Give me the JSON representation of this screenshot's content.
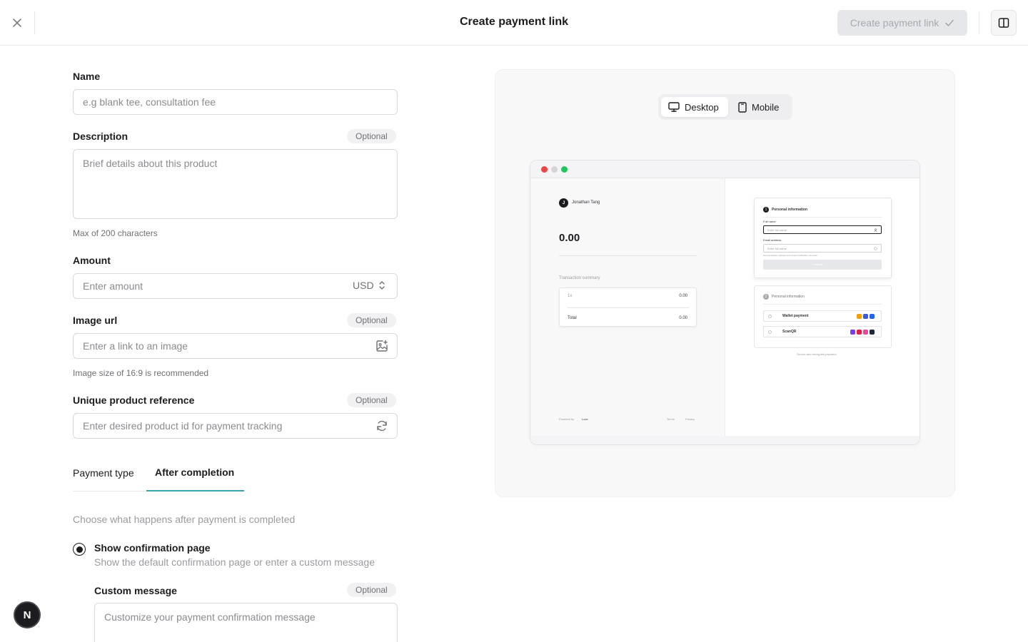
{
  "header": {
    "title": "Create payment link",
    "create_button_label": "Create payment link"
  },
  "form": {
    "name": {
      "label": "Name",
      "placeholder": "e.g blank tee, consultation fee"
    },
    "description": {
      "label": "Description",
      "badge": "Optional",
      "placeholder": "Brief details about this product",
      "hint": "Max of 200 characters"
    },
    "amount": {
      "label": "Amount",
      "placeholder": "Enter amount",
      "currency": "USD"
    },
    "image_url": {
      "label": "Image url",
      "badge": "Optional",
      "placeholder": "Enter a link to an image",
      "hint": "Image size of 16:9 is recommended"
    },
    "product_reference": {
      "label": "Unique product reference",
      "badge": "Optional",
      "placeholder": "Enter desired product id for payment tracking"
    },
    "tabs": [
      {
        "label": "Payment type",
        "active": false
      },
      {
        "label": "After completion",
        "active": true
      }
    ],
    "after_completion": {
      "description": "Choose what happens after payment is completed",
      "option_title": "Show confirmation page",
      "option_description": "Show the default confirmation page or enter a custom message",
      "custom_message": {
        "label": "Custom message",
        "badge": "Optional",
        "placeholder": "Customize your payment confirmation message"
      }
    }
  },
  "preview": {
    "toggle": [
      {
        "label": "Desktop",
        "icon": "monitor-icon",
        "active": true
      },
      {
        "label": "Mobile",
        "icon": "phone-icon",
        "active": false
      }
    ],
    "checkout": {
      "merchant_initial": "J",
      "merchant_name": "Jonathan Tang",
      "amount": "0.00",
      "summary_title": "Transaction summary",
      "line_qty": "1x",
      "line_amount": "0.00",
      "total_label": "Total",
      "total_amount": "0.00",
      "powered_by": "Powered by",
      "brand": "Loox",
      "terms": "Terms",
      "privacy": "Privacy",
      "step1_number": "1",
      "step1_title": "Personal information",
      "full_name_label": "Full name",
      "full_name_placeholder": "Enter full name",
      "email_label": "Email address",
      "email_placeholder": "Enter full name",
      "email_hint": "Get transaction updates and receipt notification via email",
      "continue_label": "Continue →",
      "step2_number": "2",
      "step2_title": "Personal information",
      "wallet_label": "Wallet payment",
      "scan_label": "ScanQR",
      "secure_note": "Secure and encrypted payment"
    }
  },
  "fab": {
    "label": "N"
  },
  "colors": {
    "accent_tab": "#3aa3b8",
    "disabled_button_bg": "#e6e7ea",
    "dot_red": "#ef4444",
    "dot_gray": "#d4d4d8",
    "dot_green": "#22c55e"
  }
}
